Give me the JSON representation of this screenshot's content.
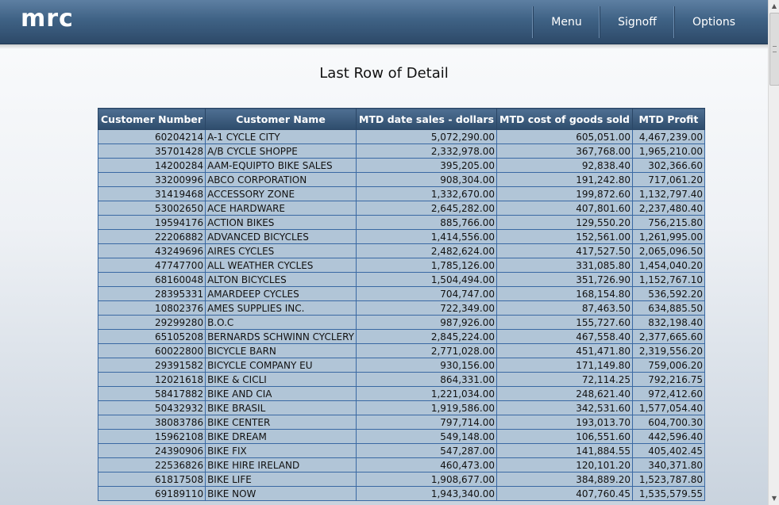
{
  "header": {
    "logo": "mrc",
    "nav": {
      "menu": "Menu",
      "signoff": "Signoff",
      "options": "Options"
    }
  },
  "page": {
    "title": "Last Row of Detail"
  },
  "table": {
    "columns": [
      "Customer Number",
      "Customer Name",
      "MTD date sales - dollars",
      "MTD cost of goods sold",
      "MTD Profit"
    ],
    "rows": [
      [
        "60204214",
        "A-1 CYCLE CITY",
        "5,072,290.00",
        "605,051.00",
        "4,467,239.00"
      ],
      [
        "35701428",
        "A/B CYCLE SHOPPE",
        "2,332,978.00",
        "367,768.00",
        "1,965,210.00"
      ],
      [
        "14200284",
        "AAM-EQUIPTO BIKE SALES",
        "395,205.00",
        "92,838.40",
        "302,366.60"
      ],
      [
        "33200996",
        "ABCO CORPORATION",
        "908,304.00",
        "191,242.80",
        "717,061.20"
      ],
      [
        "31419468",
        "ACCESSORY ZONE",
        "1,332,670.00",
        "199,872.60",
        "1,132,797.40"
      ],
      [
        "53002650",
        "ACE HARDWARE",
        "2,645,282.00",
        "407,801.60",
        "2,237,480.40"
      ],
      [
        "19594176",
        "ACTION BIKES",
        "885,766.00",
        "129,550.20",
        "756,215.80"
      ],
      [
        "22206882",
        "ADVANCED BICYCLES",
        "1,414,556.00",
        "152,561.00",
        "1,261,995.00"
      ],
      [
        "43249696",
        "AIRES CYCLES",
        "2,482,624.00",
        "417,527.50",
        "2,065,096.50"
      ],
      [
        "47747700",
        "ALL WEATHER CYCLES",
        "1,785,126.00",
        "331,085.80",
        "1,454,040.20"
      ],
      [
        "68160048",
        "ALTON BICYCLES",
        "1,504,494.00",
        "351,726.90",
        "1,152,767.10"
      ],
      [
        "28395331",
        "AMARDEEP CYCLES",
        "704,747.00",
        "168,154.80",
        "536,592.20"
      ],
      [
        "10802376",
        "AMES SUPPLIES INC.",
        "722,349.00",
        "87,463.50",
        "634,885.50"
      ],
      [
        "29299280",
        "B.O.C",
        "987,926.00",
        "155,727.60",
        "832,198.40"
      ],
      [
        "65105208",
        "BERNARDS SCHWINN CYCLERY",
        "2,845,224.00",
        "467,558.40",
        "2,377,665.60"
      ],
      [
        "60022800",
        "BICYCLE BARN",
        "2,771,028.00",
        "451,471.80",
        "2,319,556.20"
      ],
      [
        "29391582",
        "BICYCLE COMPANY EU",
        "930,156.00",
        "171,149.80",
        "759,006.20"
      ],
      [
        "12021618",
        "BIKE & CICLI",
        "864,331.00",
        "72,114.25",
        "792,216.75"
      ],
      [
        "58417882",
        "BIKE AND CIA",
        "1,221,034.00",
        "248,621.40",
        "972,412.60"
      ],
      [
        "50432932",
        "BIKE BRASIL",
        "1,919,586.00",
        "342,531.60",
        "1,577,054.40"
      ],
      [
        "38083786",
        "BIKE CENTER",
        "797,714.00",
        "193,013.70",
        "604,700.30"
      ],
      [
        "15962108",
        "BIKE DREAM",
        "549,148.00",
        "106,551.60",
        "442,596.40"
      ],
      [
        "24390906",
        "BIKE FIX",
        "547,287.00",
        "141,884.55",
        "405,402.45"
      ],
      [
        "22536826",
        "BIKE HIRE IRELAND",
        "460,473.00",
        "120,101.20",
        "340,371.80"
      ],
      [
        "61817508",
        "BIKE LIFE",
        "1,908,677.00",
        "384,889.20",
        "1,523,787.80"
      ],
      [
        "69189110",
        "BIKE NOW",
        "1,943,340.00",
        "407,760.45",
        "1,535,579.55"
      ]
    ]
  }
}
